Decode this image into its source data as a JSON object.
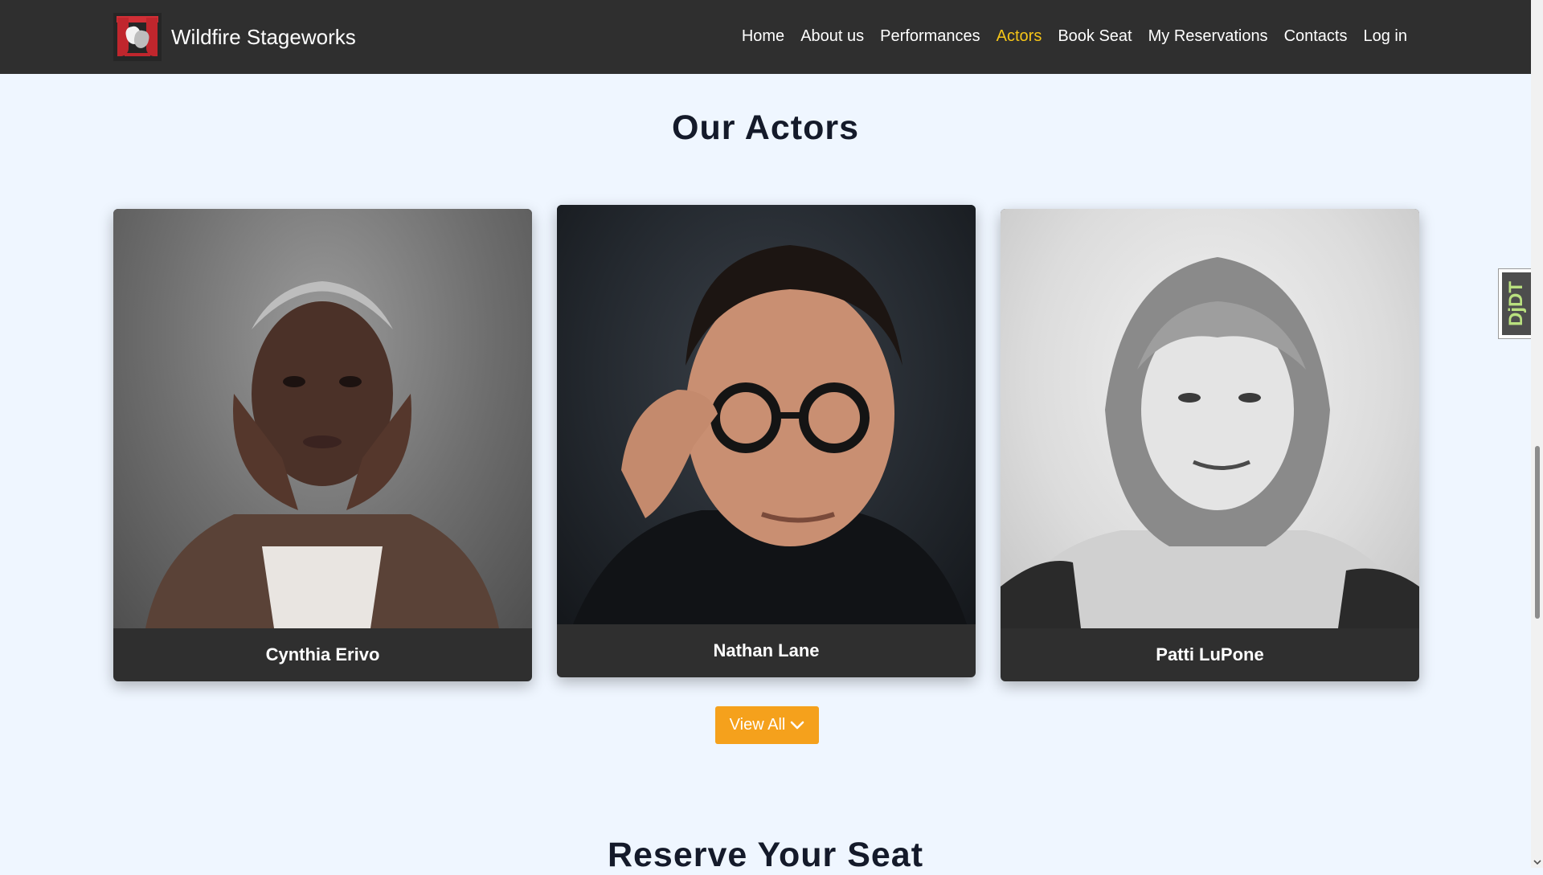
{
  "header": {
    "brand_name": "Wildfire Stageworks",
    "nav": [
      {
        "label": "Home",
        "active": false
      },
      {
        "label": "About us",
        "active": false
      },
      {
        "label": "Performances",
        "active": false
      },
      {
        "label": "Actors",
        "active": true
      },
      {
        "label": "Book Seat",
        "active": false
      },
      {
        "label": "My Reservations",
        "active": false
      },
      {
        "label": "Contacts",
        "active": false
      },
      {
        "label": "Log in",
        "active": false
      }
    ]
  },
  "actors_section": {
    "title": "Our Actors",
    "actors": [
      {
        "name": "Cynthia Erivo"
      },
      {
        "name": "Nathan Lane"
      },
      {
        "name": "Patti LuPone"
      }
    ],
    "view_all_label": "View All",
    "view_all_icon": "chevron-down-icon"
  },
  "reserve_section": {
    "title": "Reserve Your Seat"
  },
  "extension_tab": {
    "label": "DjDT"
  },
  "colors": {
    "navbar_bg": "#2f2f2f",
    "page_bg": "#eff6ff",
    "active_nav": "#f5c518",
    "button_bg": "#f5a11c",
    "card_caption_bg": "#2f2f2f"
  }
}
